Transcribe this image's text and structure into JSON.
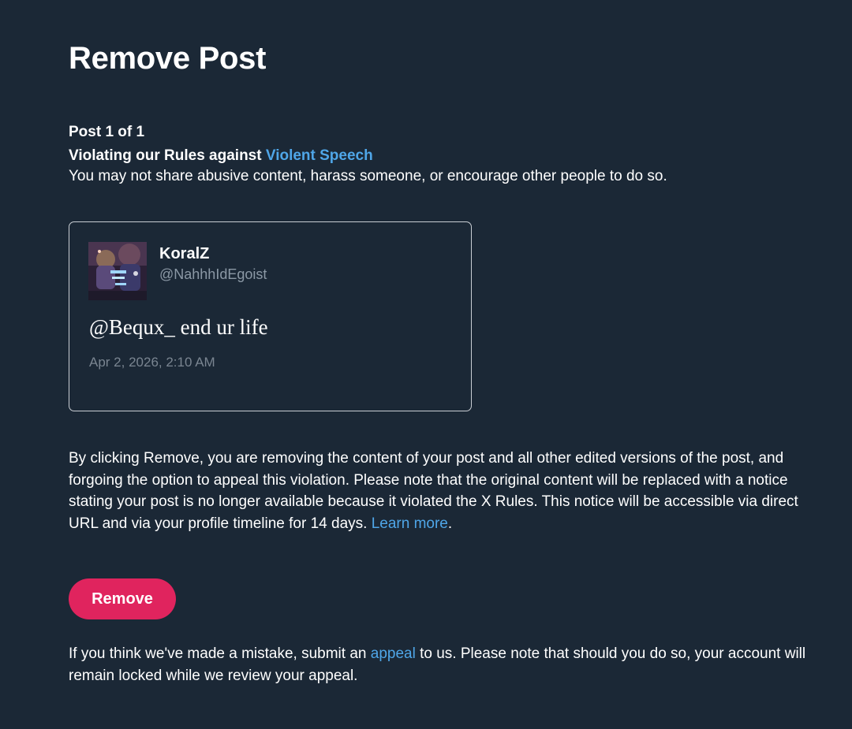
{
  "page": {
    "title": "Remove Post"
  },
  "violation": {
    "post_count": "Post 1 of 1",
    "heading_prefix": "Violating our Rules against ",
    "rule_link": "Violent Speech",
    "description": "You may not share abusive content, harass someone, or encourage other people to do so."
  },
  "post": {
    "author_name": "KoralZ",
    "author_handle": "@NahhhIdEgoist",
    "text": "@Bequx_ end ur life",
    "date": "Apr 2, 2026, 2:10 AM",
    "avatar_icon": "profile-avatar-image"
  },
  "notice": {
    "text": "By clicking Remove, you are removing the content of your post and all other edited versions of the post, and forgoing the option to appeal this violation. Please note that the original content will be replaced with a notice stating your post is no longer available because it violated the X Rules. This notice will be accessible via direct URL and via your profile timeline for 14 days. ",
    "learn_more": "Learn more",
    "period": "."
  },
  "actions": {
    "remove_label": "Remove"
  },
  "appeal": {
    "prefix": "If you think we've made a mistake, submit an ",
    "link": "appeal",
    "suffix": " to us. Please note that should you do so, your account will remain locked while we review your appeal."
  },
  "colors": {
    "background": "#1b2836",
    "link": "#4fa6e8",
    "remove_button": "#e0245e",
    "secondary_text": "#8b98a5"
  }
}
